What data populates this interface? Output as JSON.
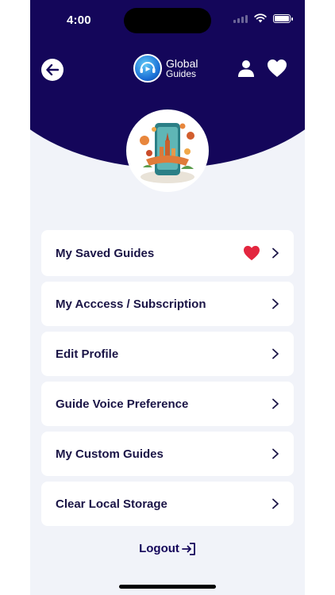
{
  "status_bar": {
    "time": "4:00"
  },
  "header": {
    "logo_line1": "Global",
    "logo_line2": "Guides",
    "brand_color": "#14065a"
  },
  "menu": {
    "items": [
      {
        "label": "My Saved Guides",
        "icon": "heart-icon"
      },
      {
        "label": "My Acccess / Subscription"
      },
      {
        "label": "Edit Profile"
      },
      {
        "label": "Guide Voice Preference"
      },
      {
        "label": "My Custom Guides"
      },
      {
        "label": "Clear Local Storage"
      }
    ]
  },
  "logout": {
    "label": "Logout"
  },
  "colors": {
    "accent_red": "#e3263f",
    "background": "#f1f3f9",
    "text": "#1a1446"
  }
}
